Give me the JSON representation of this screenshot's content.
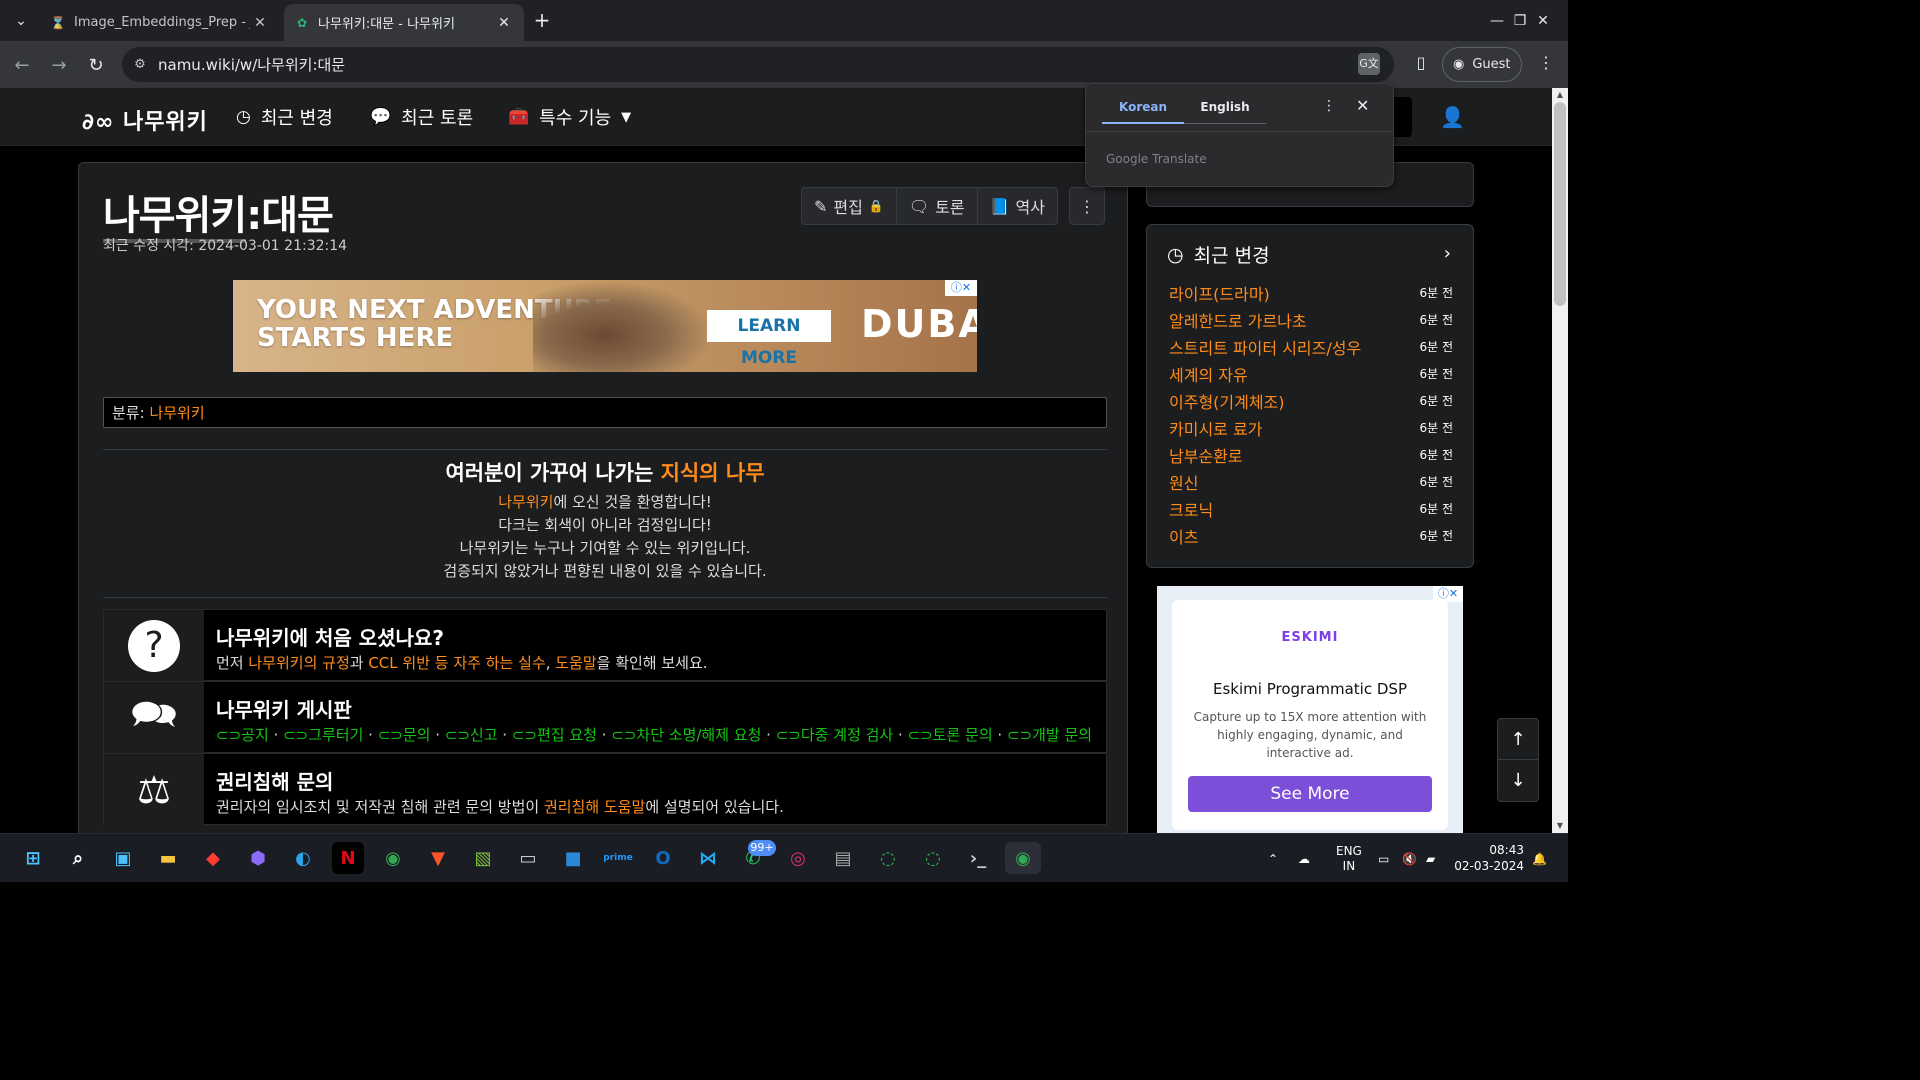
{
  "browser": {
    "tabs": [
      {
        "title": "Image_Embeddings_Prep - Jupyt",
        "favicon": "hourglass-icon"
      },
      {
        "title": "나무위키:대문 - 나무위키",
        "favicon": "namuwiki-icon"
      }
    ],
    "url": "namu.wiki/w/나무위키:대문",
    "profile_label": "Guest"
  },
  "translate_popup": {
    "lang_source": "Korean",
    "lang_target": "English",
    "brand": "Google Translate"
  },
  "site": {
    "logo_text": "나무위키",
    "nav": [
      {
        "label": "최근 변경",
        "icon": "clock-icon"
      },
      {
        "label": "최근 토론",
        "icon": "comments-icon"
      },
      {
        "label": "특수 기능",
        "icon": "toolbox-icon"
      }
    ]
  },
  "article": {
    "title_prefix": "나무위키",
    "title_suffix": ":대문",
    "last_modified": "최근 수정 시각: 2024-03-01 21:32:14",
    "buttons": {
      "edit": "편집",
      "discuss": "토론",
      "history": "역사"
    },
    "ad": {
      "headline_1": "YOUR NEXT ADVENTURE",
      "headline_2": "STARTS HERE",
      "cta": "LEARN MORE",
      "brand": "DUBAI"
    },
    "category_label": "분류:",
    "category_value": "나무위키",
    "welcome": {
      "heading_a": "여러분이 가꾸어 나가는 ",
      "heading_b": "지식의 나무",
      "line1_link": "나무위키",
      "line1_rest": "에 오신 것을 환영합니다!",
      "line2": "다크는 회색이 아니라 검정입니다!",
      "line3": "나무위키는 누구나 기여할 수 있는 위키입니다.",
      "line4": "검증되지 않았거나 편향된 내용이 있을 수 있습니다."
    },
    "boxes": [
      {
        "title": "나무위키에 처음 오셨나요?",
        "d1": "먼저 ",
        "l1": "나무위키의 규정",
        "d2": "과 ",
        "l2": "CCL 위반 등 자주 하는 실수",
        "d3": ", ",
        "l3": "도움말",
        "d4": "을 확인해 보세요."
      },
      {
        "title": "나무위키 게시판",
        "links": [
          "공지",
          "그루터기",
          "문의",
          "신고",
          "편집 요청",
          "차단 소명/해제 요청",
          "다중 계정 검사",
          "토론 문의",
          "개발 문의"
        ]
      },
      {
        "title": "권리침해 문의",
        "d1": "권리자의 임시조치 및 저작권 침해 관련 문의 방법이 ",
        "l1": "권리침해 도움말",
        "d2": "에 설명되어 있습니다."
      }
    ]
  },
  "sidebar": {
    "recent_title": "최근 변경",
    "recent_items": [
      {
        "title": "라이프(드라마)",
        "time": "6분 전"
      },
      {
        "title": "알레한드로 가르나초",
        "time": "6분 전"
      },
      {
        "title": "스트리트 파이터 시리즈/성우",
        "time": "6분 전"
      },
      {
        "title": "세계의 자유",
        "time": "6분 전"
      },
      {
        "title": "이주형(기계체조)",
        "time": "6분 전"
      },
      {
        "title": "카미시로 료가",
        "time": "6분 전"
      },
      {
        "title": "남부순환로",
        "time": "6분 전"
      },
      {
        "title": "원신",
        "time": "6분 전"
      },
      {
        "title": "크로닉",
        "time": "6분 전"
      },
      {
        "title": "이츠",
        "time": "6분 전"
      }
    ],
    "ad": {
      "logo": "ESKIMI",
      "title": "Eskimi Programmatic DSP",
      "desc": "Capture up to 15X more attention with highly engaging, dynamic, and interactive ad.",
      "cta": "See More"
    }
  },
  "taskbar": {
    "whatsapp_badge": "99+",
    "lang_1": "ENG",
    "lang_2": "IN",
    "time": "08:43",
    "date": "02-03-2024"
  },
  "colors": {
    "link": "#ff8c1a",
    "board_link": "#14c414",
    "accent": "#8ab4f8"
  }
}
